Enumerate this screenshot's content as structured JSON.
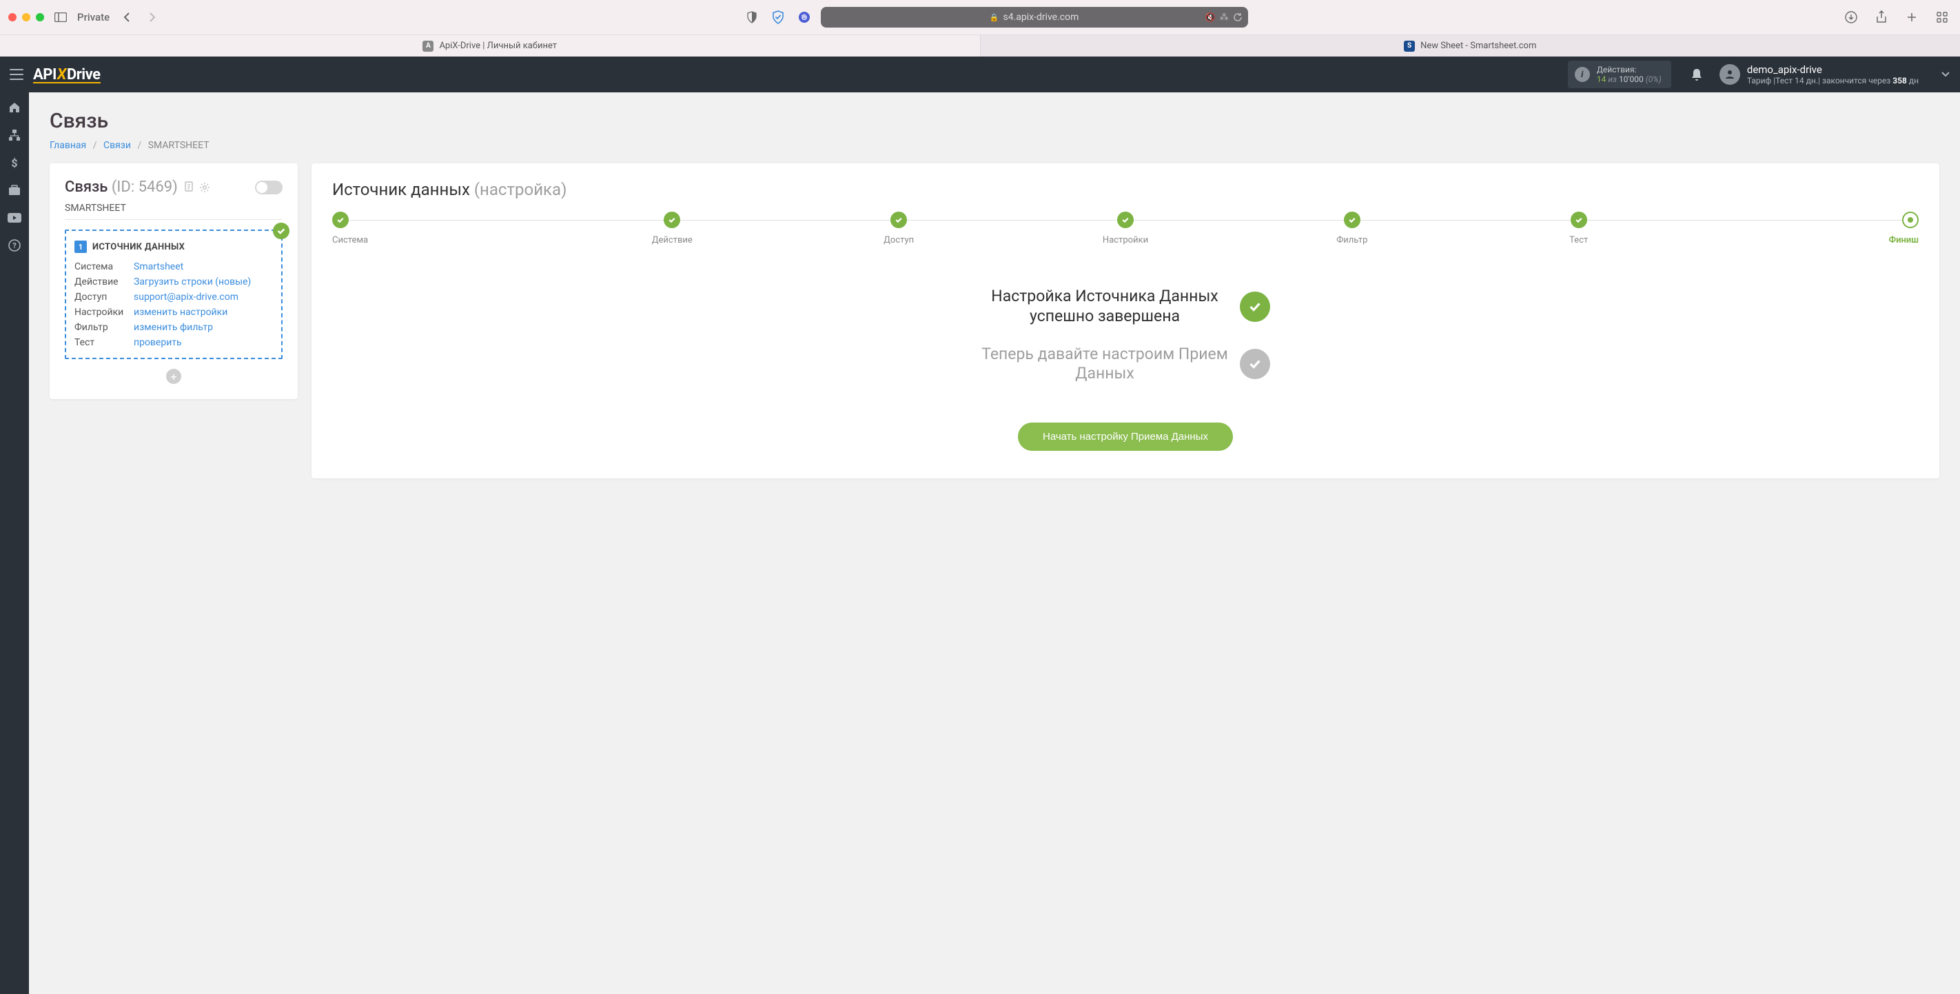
{
  "browser": {
    "private_label": "Private",
    "url_host": "s4.apix-drive.com",
    "tabs": [
      {
        "label": "ApiX-Drive | Личный кабинет",
        "favicon": "A"
      },
      {
        "label": "New Sheet - Smartsheet.com",
        "favicon": "S"
      }
    ]
  },
  "header": {
    "actions_label": "Действия:",
    "actions_count": "14",
    "actions_iz": "из",
    "actions_total": "10'000",
    "actions_pct": "(0%)",
    "user_name": "demo_apix-drive",
    "tariff_prefix": "Тариф",
    "tariff_name": "Тест 14 дн.",
    "tariff_mid": "закончится через",
    "tariff_days": "358",
    "tariff_suffix": "дн"
  },
  "page": {
    "title": "Связь",
    "crumb_home": "Главная",
    "crumb_links": "Связи",
    "crumb_current": "SMARTSHEET"
  },
  "left_panel": {
    "title": "Связь",
    "id_label": "(ID: 5469)",
    "name": "SMARTSHEET",
    "source": {
      "number": "1",
      "title": "ИСТОЧНИК ДАННЫХ",
      "rows": [
        {
          "k": "Система",
          "v": "Smartsheet"
        },
        {
          "k": "Действие",
          "v": "Загрузить строки (новые)"
        },
        {
          "k": "Доступ",
          "v": "support@apix-drive.com"
        },
        {
          "k": "Настройки",
          "v": "изменить настройки"
        },
        {
          "k": "Фильтр",
          "v": "изменить фильтр"
        },
        {
          "k": "Тест",
          "v": "проверить"
        }
      ]
    }
  },
  "right_panel": {
    "title_main": "Источник данных",
    "title_sub": "(настройка)",
    "steps": [
      {
        "label": "Система",
        "state": "done"
      },
      {
        "label": "Действие",
        "state": "done"
      },
      {
        "label": "Доступ",
        "state": "done"
      },
      {
        "label": "Настройки",
        "state": "done"
      },
      {
        "label": "Фильтр",
        "state": "done"
      },
      {
        "label": "Тест",
        "state": "done"
      },
      {
        "label": "Финиш",
        "state": "current"
      }
    ],
    "done_msg": "Настройка Источника Данных успешно завершена",
    "next_msg": "Теперь давайте настроим Прием Данных",
    "cta": "Начать настройку Приема Данных"
  }
}
